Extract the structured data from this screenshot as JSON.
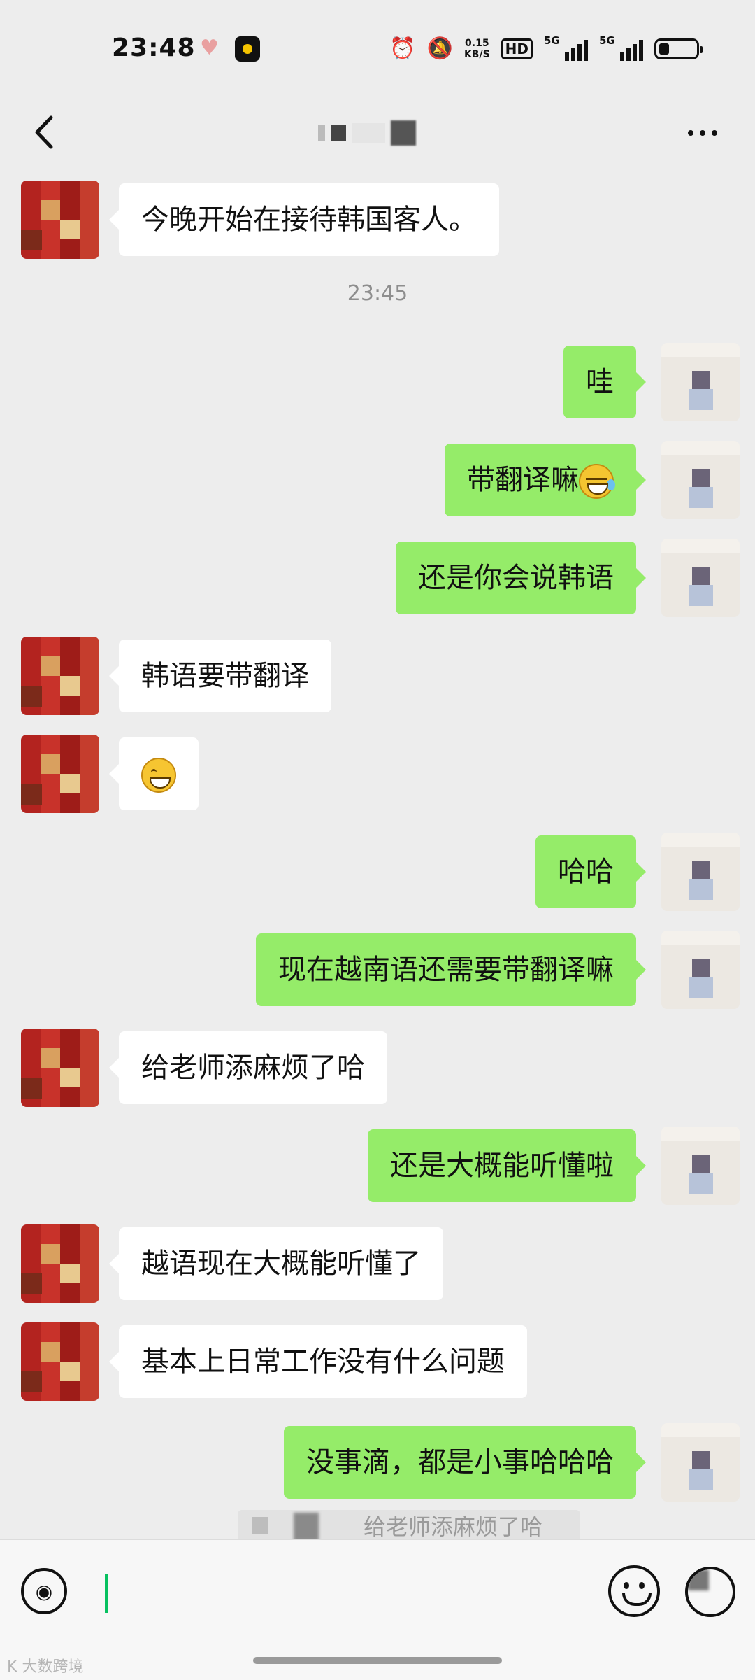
{
  "status_bar": {
    "time": "23:48",
    "net_speed_value": "0.15",
    "net_speed_unit": "KB/S",
    "hd_label": "HD",
    "sim1_label": "5G",
    "sim2_label": "5G",
    "icons": [
      "heart-icon",
      "app-icon",
      "alarm-icon",
      "mute-icon",
      "signal-icon",
      "battery-icon"
    ]
  },
  "header": {
    "back_icon": "chevron-left-icon",
    "more_icon": "more-dots-icon"
  },
  "messages": [
    {
      "side": "other",
      "text": "今晚开始在接待韩国客人。"
    },
    {
      "type": "time",
      "text": "23:45"
    },
    {
      "side": "self",
      "text": "哇"
    },
    {
      "side": "self",
      "text": "带翻译嘛",
      "emoji": "laugh-cry-emoji"
    },
    {
      "side": "self",
      "text": "还是你会说韩语"
    },
    {
      "side": "other",
      "text": "韩语要带翻译"
    },
    {
      "side": "other",
      "text": "",
      "emoji": "grin-emoji"
    },
    {
      "side": "self",
      "text": "哈哈"
    },
    {
      "side": "self",
      "text": "现在越南语还需要带翻译嘛"
    },
    {
      "side": "other",
      "text": "给老师添麻烦了哈"
    },
    {
      "side": "self",
      "text": "还是大概能听懂啦"
    },
    {
      "side": "other",
      "text": "越语现在大概能听懂了"
    },
    {
      "side": "other",
      "text": "基本上日常工作没有什么问题"
    },
    {
      "side": "self",
      "text": "没事滴，都是小事哈哈哈"
    }
  ],
  "quote": {
    "text": "给老师添麻烦了哈"
  },
  "input_bar": {
    "voice_icon": "voice-icon",
    "emoji_icon": "emoji-icon",
    "plus_icon": "plus-icon"
  },
  "watermark": "K 大数跨境"
}
